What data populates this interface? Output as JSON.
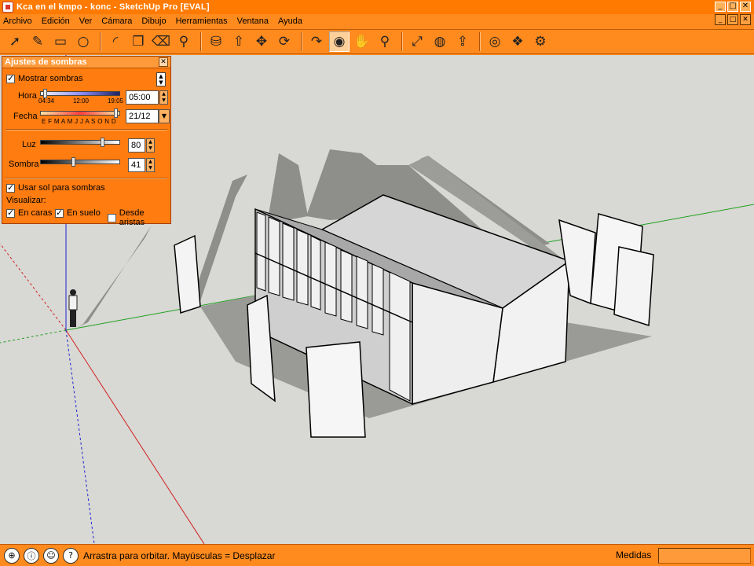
{
  "window": {
    "title": "Kса en el kmpo - konc - SketchUp Pro [EVAL]",
    "buttons": [
      "_",
      "□",
      "✕"
    ]
  },
  "menu": {
    "items": [
      "Archivo",
      "Edición",
      "Ver",
      "Cámara",
      "Dibujo",
      "Herramientas",
      "Ventana",
      "Ayuda"
    ]
  },
  "toolbar": {
    "tools": [
      {
        "name": "select-icon",
        "glyph": "➚"
      },
      {
        "name": "pencil-icon",
        "glyph": "✎"
      },
      {
        "name": "rectangle-icon",
        "glyph": "▭"
      },
      {
        "name": "circle-icon",
        "glyph": "○"
      },
      {
        "name": "arc-icon",
        "glyph": "◜"
      },
      {
        "name": "make-component-icon",
        "glyph": "❒"
      },
      {
        "name": "eraser-icon",
        "glyph": "⌫"
      },
      {
        "name": "tape-measure-icon",
        "glyph": "⚲"
      },
      {
        "name": "paint-bucket-icon",
        "glyph": "⛁"
      },
      {
        "name": "push-pull-icon",
        "glyph": "⇧"
      },
      {
        "name": "move-icon",
        "glyph": "✥"
      },
      {
        "name": "rotate-icon",
        "glyph": "⟳"
      },
      {
        "name": "follow-me-icon",
        "glyph": "↷"
      },
      {
        "name": "orbit-icon",
        "glyph": "◉"
      },
      {
        "name": "pan-icon",
        "glyph": "✋"
      },
      {
        "name": "zoom-icon",
        "glyph": "⚲"
      },
      {
        "name": "zoom-extents-icon",
        "glyph": "⤢"
      },
      {
        "name": "get-models-icon",
        "glyph": "◍"
      },
      {
        "name": "share-model-icon",
        "glyph": "⇪"
      },
      {
        "name": "google-earth-icon",
        "glyph": "◎"
      },
      {
        "name": "components-icon",
        "glyph": "❖"
      },
      {
        "name": "extension-icon",
        "glyph": "⚙"
      }
    ]
  },
  "shadow_panel": {
    "title": "Ajustes de sombras",
    "show_shadows_label": "Mostrar sombras",
    "show_shadows": true,
    "time_label": "Hora",
    "time_ticks": [
      "04:34",
      "12:00",
      "19:05"
    ],
    "time_value": "05:00",
    "time_slider": 0.03,
    "date_label": "Fecha",
    "date_ticks": "E F M A M J J A S O N D",
    "date_value": "21/12",
    "date_slider": 0.98,
    "light_label": "Luz",
    "light_value": "80",
    "light_slider": 0.8,
    "dark_label": "Sombra",
    "dark_value": "41",
    "dark_slider": 0.41,
    "use_sun_label": "Usar sol para sombras",
    "use_sun": true,
    "display_label": "Visualizar:",
    "on_faces_label": "En caras",
    "on_faces": true,
    "on_ground_label": "En suelo",
    "on_ground": true,
    "from_edges_label": "Desde aristas",
    "from_edges": false
  },
  "status": {
    "hint": "Arrastra para orbitar.  Mayúsculas = Desplazar",
    "measures_label": "Medidas",
    "measures_value": ""
  },
  "colors": {
    "chrome": "#ff8a1e",
    "viewport": "#d8d8d4",
    "axis_red": "#d02020",
    "axis_green": "#20a020",
    "axis_blue": "#2020d0"
  }
}
